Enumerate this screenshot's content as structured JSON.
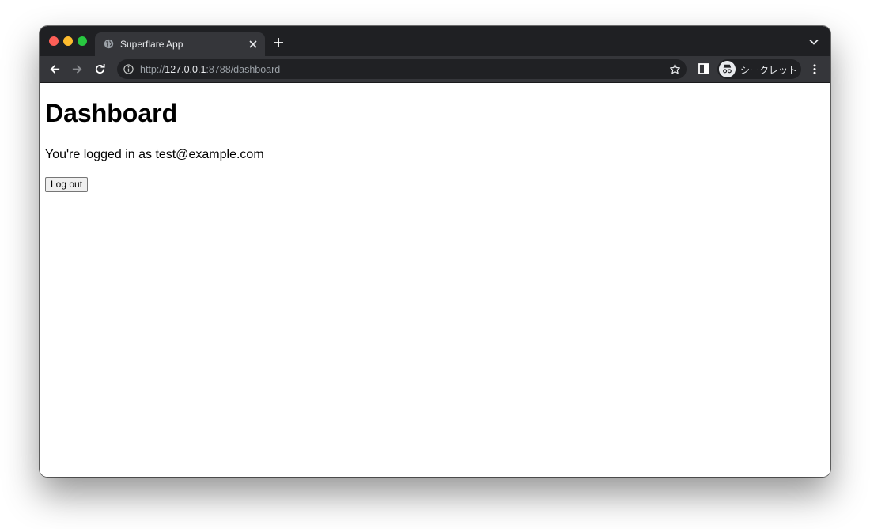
{
  "browser": {
    "tab": {
      "title": "Superflare App",
      "favicon": "globe-icon"
    },
    "url": {
      "scheme": "http://",
      "host": "127.0.0.1",
      "rest": ":8788/dashboard"
    },
    "profile": {
      "label": "シークレット",
      "icon": "incognito-icon"
    },
    "colors": {
      "frame": "#1f2023",
      "toolbar": "#35363a",
      "omnibox": "#202124",
      "text": "#e8eaed"
    }
  },
  "page": {
    "title": "Dashboard",
    "logged_in_text": "You're logged in as test@example.com",
    "logout_label": "Log out"
  }
}
